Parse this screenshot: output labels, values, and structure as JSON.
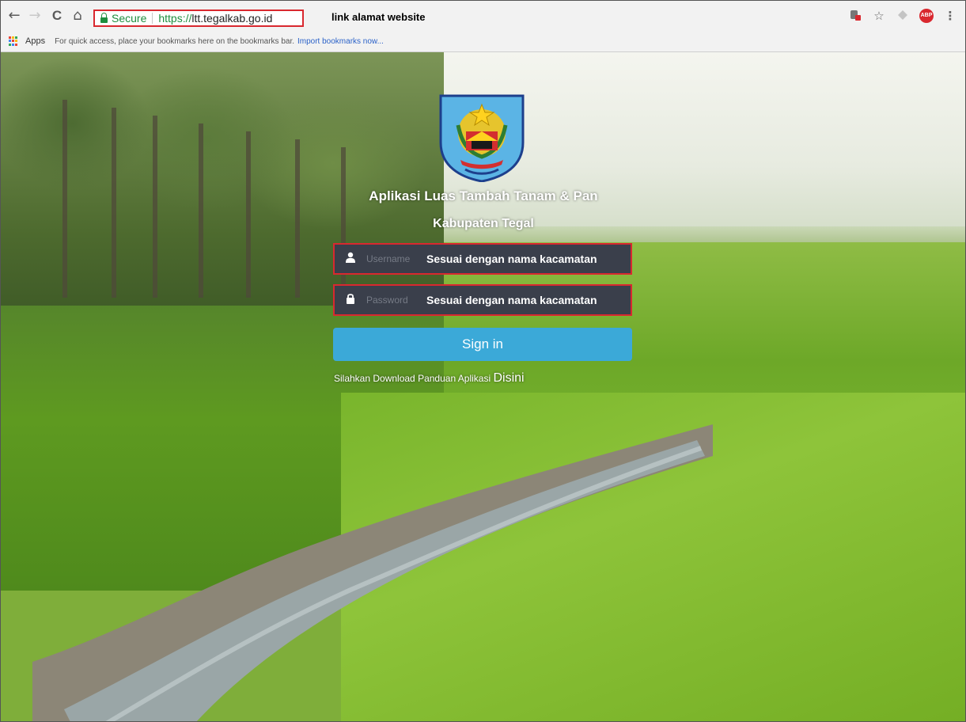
{
  "browser": {
    "nav": {
      "back": "←",
      "forward": "→",
      "reload": "C",
      "home": "⌂"
    },
    "address": {
      "secure_label": "Secure",
      "protocol": "https://",
      "host": "ltt.tegalkab.go.id"
    },
    "annotation": "link alamat website",
    "right_icons": [
      "extension-icon",
      "star-icon",
      "extension-grey-icon",
      "adblock-icon",
      "menu-icon"
    ],
    "adblock_label": "ABP",
    "bookmarks": {
      "apps_label": "Apps",
      "message": "For quick access, place your bookmarks here on the bookmarks bar.",
      "import_link": "Import bookmarks now..."
    }
  },
  "login": {
    "title": "Aplikasi Luas Tambah Tanam & Pan",
    "subtitle": "Kabupaten Tegal",
    "username": {
      "placeholder": "Username",
      "note": "Sesuai dengan nama kacamatan"
    },
    "password": {
      "placeholder": "Password",
      "note": "Sesuai dengan nama kacamatan"
    },
    "signin_label": "Sign in",
    "download_text": "Silahkan Download Panduan Aplikasi",
    "download_link": "Disini"
  },
  "colors": {
    "highlight": "#d9282f",
    "signin": "#3ba9d8",
    "field_bg": "#3a3f4b"
  }
}
